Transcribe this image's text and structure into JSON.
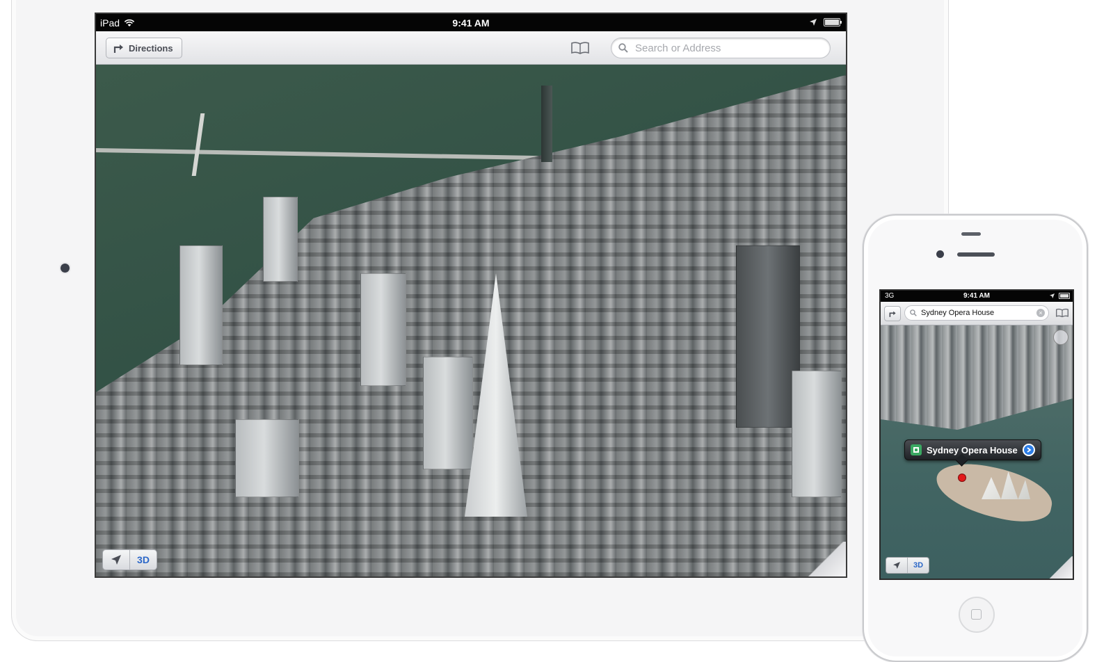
{
  "ipad": {
    "status": {
      "carrier": "iPad",
      "time": "9:41 AM"
    },
    "toolbar": {
      "directions_label": "Directions",
      "search_placeholder": "Search or Address"
    },
    "map_controls": {
      "mode_label": "3D"
    }
  },
  "iphone": {
    "status": {
      "carrier": "3G",
      "time": "9:41 AM"
    },
    "toolbar": {
      "search_value": "Sydney Opera House",
      "clear_glyph": "×"
    },
    "callout": {
      "title": "Sydney Opera House"
    },
    "map_controls": {
      "mode_label": "3D"
    }
  },
  "colors": {
    "accent_blue": "#2b67c8",
    "pin_red": "#e21a1a",
    "callout_green": "#3aa862"
  },
  "icons": [
    "directions-arrow-icon",
    "bookmarks-icon",
    "search-icon",
    "location-arrow-icon",
    "wifi-icon",
    "battery-icon",
    "compass-icon",
    "disclosure-icon"
  ]
}
